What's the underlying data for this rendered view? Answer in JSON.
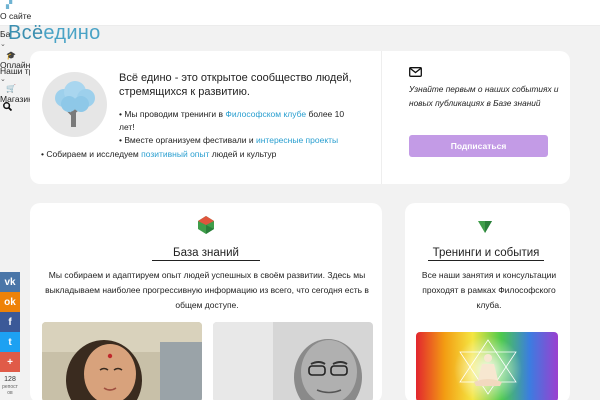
{
  "logo": {
    "part1": "Всё",
    "part2": "едино"
  },
  "nav": [
    {
      "label": "О сайте",
      "icon": "map-icon"
    },
    {
      "label": "Ба",
      "icon": ""
    },
    {
      "label": "Оплайн школа",
      "icon": "graduation-cap-icon"
    },
    {
      "label": "Наши тренинги",
      "icon": ""
    },
    {
      "label": "Магазин",
      "icon": "cart-icon"
    }
  ],
  "intro": {
    "title": "Всё едино - это открытое сообщество людей, стремящихся к развитию.",
    "b1_pre": "• Мы проводим тренинги в ",
    "b1_link": "Философском клубе",
    "b1_post": " более 10",
    "b1_cont": "лет!",
    "b2_pre": "• Вместе организуем фестивали и ",
    "b2_link": "интересные проекты",
    "b3_pre": "• Собираем и исследуем ",
    "b3_link": "позитивный опыт",
    "b3_post": " людей и культур"
  },
  "subscribe": {
    "text": "Узнайте первым о наших событиях и новых публикациях в Базе знаний",
    "button": "Подписаться"
  },
  "knowledge": {
    "title": "База знаний",
    "desc": "Мы собираем и адаптируем опыт людей успешных в своём развитии. Здесь мы выкладываем наиболее прогрессивную информацию из всего, что сегодня есть в общем доступе."
  },
  "events": {
    "title": "Тренинги и события",
    "desc": "Все наши занятия и консультации проходят в рамках Философского клуба."
  },
  "share": {
    "buttons": [
      {
        "label": "vk",
        "color": "#4a76a8"
      },
      {
        "label": "ok",
        "color": "#ee8208"
      },
      {
        "label": "f",
        "color": "#3b5998"
      },
      {
        "label": "t",
        "color": "#1da1f2"
      },
      {
        "label": "+",
        "color": "#e05b48"
      }
    ],
    "count": "128",
    "count_label": "репост ов"
  },
  "colors": {
    "accent": "#2a9fd0",
    "button": "#c39be6",
    "logo": "#4aa3c6"
  }
}
